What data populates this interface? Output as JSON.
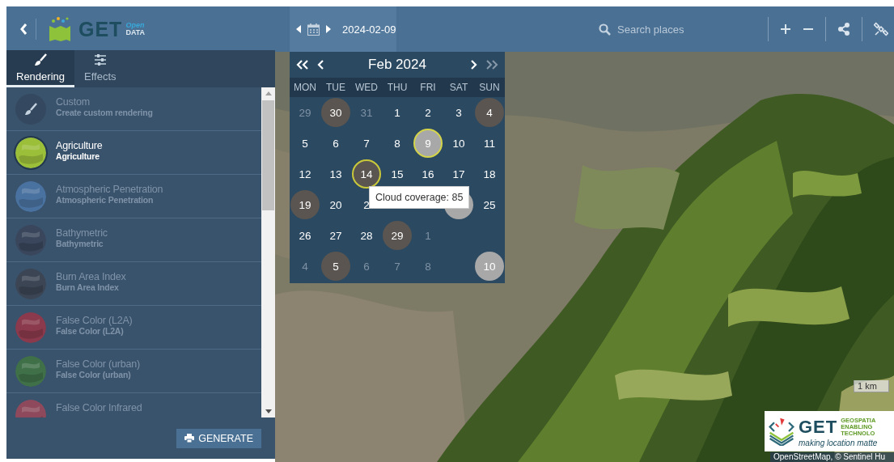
{
  "header": {
    "logo": {
      "name": "GET",
      "super": "Open",
      "sub": "DATA"
    },
    "date": "2024-02-09",
    "search": {
      "placeholder": "Search places"
    }
  },
  "sidebar": {
    "tabs": [
      {
        "label": "Rendering",
        "selected": true
      },
      {
        "label": "Effects",
        "selected": false
      }
    ],
    "items": [
      {
        "kind": "custom",
        "title": "Custom",
        "subtitle": "Create custom rendering",
        "selected": false
      },
      {
        "kind": "preset",
        "title": "Agriculture",
        "subtitle": "Agriculture",
        "color": "#9cbf3a",
        "selected": true
      },
      {
        "kind": "preset",
        "title": "Atmospheric Penetration",
        "subtitle": "Atmospheric Penetration",
        "color": "#4a72a0",
        "selected": false
      },
      {
        "kind": "preset",
        "title": "Bathymetric",
        "subtitle": "Bathymetric",
        "color": "#39465c",
        "selected": false
      },
      {
        "kind": "preset",
        "title": "Burn Area Index",
        "subtitle": "Burn Area Index",
        "color": "#3b4554",
        "selected": false
      },
      {
        "kind": "preset",
        "title": "False Color (L2A)",
        "subtitle": "False Color (L2A)",
        "color": "#8a3a4c",
        "selected": false
      },
      {
        "kind": "preset",
        "title": "False Color (urban)",
        "subtitle": "False Color (urban)",
        "color": "#3f7048",
        "selected": false
      },
      {
        "kind": "preset",
        "title": "False Color Infrared",
        "color": "#8e4a5c",
        "selected": false
      }
    ],
    "button": "GENERATE"
  },
  "calendar": {
    "month": "Feb 2024",
    "weekdays": [
      "MON",
      "TUE",
      "WED",
      "THU",
      "FRI",
      "SAT",
      "SUN"
    ],
    "weeks": [
      [
        {
          "label": "29",
          "kind": "plain",
          "muted": true,
          "selected": false,
          "hovered": false
        },
        {
          "label": "30",
          "kind": "dark",
          "muted": false,
          "selected": false,
          "hovered": false
        },
        {
          "label": "31",
          "kind": "plain",
          "muted": true,
          "selected": false,
          "hovered": false
        },
        {
          "label": "1",
          "kind": "plain",
          "muted": false,
          "selected": false,
          "hovered": false
        },
        {
          "label": "2",
          "kind": "plain",
          "muted": false,
          "selected": false,
          "hovered": false
        },
        {
          "label": "3",
          "kind": "plain",
          "muted": false,
          "selected": false,
          "hovered": false
        },
        {
          "label": "4",
          "kind": "dark",
          "muted": false,
          "selected": false,
          "hovered": false
        }
      ],
      [
        {
          "label": "5",
          "kind": "plain",
          "muted": false,
          "selected": false,
          "hovered": false
        },
        {
          "label": "6",
          "kind": "plain",
          "muted": false,
          "selected": false,
          "hovered": false
        },
        {
          "label": "7",
          "kind": "plain",
          "muted": false,
          "selected": false,
          "hovered": false
        },
        {
          "label": "8",
          "kind": "plain",
          "muted": false,
          "selected": false,
          "hovered": false
        },
        {
          "label": "9",
          "kind": "light",
          "muted": false,
          "selected": true,
          "hovered": false
        },
        {
          "label": "10",
          "kind": "plain",
          "muted": false,
          "selected": false,
          "hovered": false
        },
        {
          "label": "11",
          "kind": "plain",
          "muted": false,
          "selected": false,
          "hovered": false
        }
      ],
      [
        {
          "label": "12",
          "kind": "plain",
          "muted": false,
          "selected": false,
          "hovered": false
        },
        {
          "label": "13",
          "kind": "plain",
          "muted": false,
          "selected": false,
          "hovered": false
        },
        {
          "label": "14",
          "kind": "dark",
          "muted": false,
          "selected": false,
          "hovered": true
        },
        {
          "label": "15",
          "kind": "plain",
          "muted": false,
          "selected": false,
          "hovered": false
        },
        {
          "label": "16",
          "kind": "plain",
          "muted": false,
          "selected": false,
          "hovered": false
        },
        {
          "label": "17",
          "kind": "plain",
          "muted": false,
          "selected": false,
          "hovered": false
        },
        {
          "label": "18",
          "kind": "plain",
          "muted": false,
          "selected": false,
          "hovered": false
        }
      ],
      [
        {
          "label": "19",
          "kind": "dark",
          "muted": false,
          "selected": false,
          "hovered": false
        },
        {
          "label": "20",
          "kind": "plain",
          "muted": false,
          "selected": false,
          "hovered": false
        },
        {
          "label": "2",
          "kind": "plain",
          "muted": false,
          "selected": false,
          "hovered": false
        },
        {
          "kind": "blank"
        },
        {
          "kind": "blank"
        },
        {
          "kind": "light",
          "selected": false,
          "hovered": false
        },
        {
          "label": "25",
          "kind": "plain",
          "muted": false,
          "selected": false,
          "hovered": false
        }
      ],
      [
        {
          "label": "26",
          "kind": "plain",
          "muted": false,
          "selected": false,
          "hovered": false
        },
        {
          "label": "27",
          "kind": "plain",
          "muted": false,
          "selected": false,
          "hovered": false
        },
        {
          "label": "28",
          "kind": "plain",
          "muted": false,
          "selected": false,
          "hovered": false
        },
        {
          "label": "29",
          "kind": "dark",
          "muted": false,
          "selected": false,
          "hovered": false
        },
        {
          "label": "1",
          "kind": "plain",
          "muted": true,
          "selected": false,
          "hovered": false
        },
        {
          "kind": "blank"
        },
        {
          "kind": "blank"
        }
      ],
      [
        {
          "label": "4",
          "kind": "plain",
          "muted": true,
          "selected": false,
          "hovered": false
        },
        {
          "label": "5",
          "kind": "dark",
          "muted": false,
          "selected": false,
          "hovered": false
        },
        {
          "label": "6",
          "kind": "plain",
          "muted": true,
          "selected": false,
          "hovered": false
        },
        {
          "label": "7",
          "kind": "plain",
          "muted": true,
          "selected": false,
          "hovered": false
        },
        {
          "label": "8",
          "kind": "plain",
          "muted": true,
          "selected": false,
          "hovered": false
        },
        {
          "kind": "blank"
        },
        {
          "label": "10",
          "kind": "light",
          "muted": false,
          "selected": false,
          "hovered": false
        }
      ]
    ],
    "tooltip": "Cloud coverage: 85"
  },
  "map": {
    "kind": "picture",
    "scale": "1 km",
    "brand": {
      "name": "GET",
      "lines": [
        "GEOSPATIA",
        "ENABLING",
        "TECHNOLO"
      ],
      "slogan": "making location matte"
    },
    "attribution": "OpenStreetMap, © Sentinel Hu"
  }
}
